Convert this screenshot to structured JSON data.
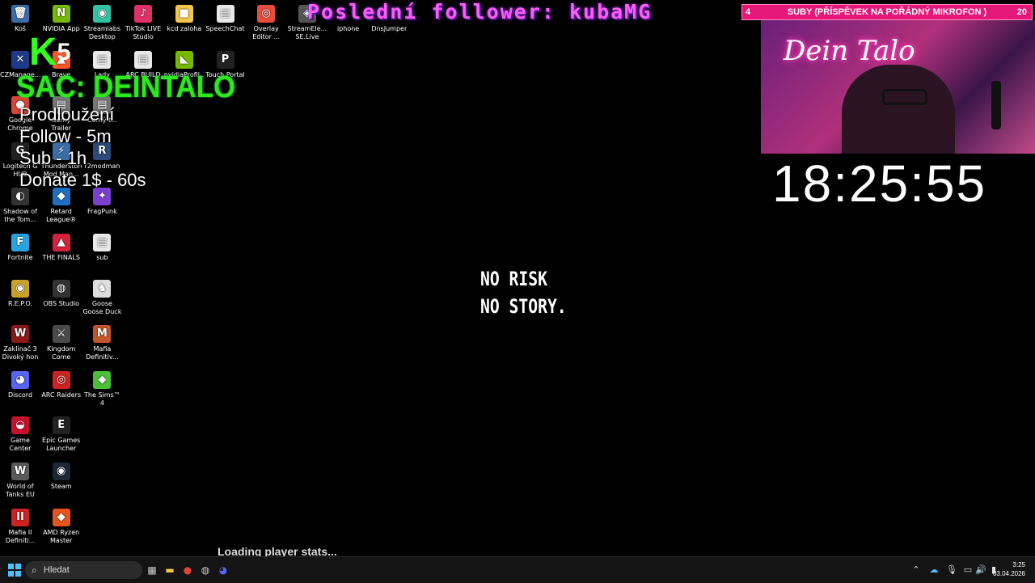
{
  "desktop_icons": [
    {
      "label": "Koš",
      "glyph": "🗑",
      "color": "#3b6ea8"
    },
    {
      "label": "NVIDIA App",
      "glyph": "N",
      "color": "#76b900"
    },
    {
      "label": "Streamlabs Desktop",
      "glyph": "◉",
      "color": "#31c3a2"
    },
    {
      "label": "TikTok LIVE Studio",
      "glyph": "♪",
      "color": "#e0306a"
    },
    {
      "label": "kcd zaloha",
      "glyph": "■",
      "color": "#f2c84b"
    },
    {
      "label": "SpeechChat",
      "glyph": "▤",
      "color": "#e8e8e8"
    },
    {
      "label": "Overlay Editor ...",
      "glyph": "◎",
      "color": "#e74c3c"
    },
    {
      "label": "StreamEle... SE.Live",
      "glyph": "◈",
      "color": "#555"
    },
    {
      "label": "iphone",
      "glyph": "",
      "color": "transparent"
    },
    {
      "label": "DnsJumper",
      "glyph": "",
      "color": "transparent"
    },
    {
      "label": "CZManage...",
      "glyph": "✕",
      "color": "#1e3a8a"
    },
    {
      "label": "Brave",
      "glyph": "▲",
      "color": "#fb542b"
    },
    {
      "label": "Lady",
      "glyph": "▤",
      "color": "#e8e8e8"
    },
    {
      "label": "ARC BUILD",
      "glyph": "▤",
      "color": "#e8e8e8"
    },
    {
      "label": "nvidiaProfil...",
      "glyph": "◣",
      "color": "#76b900"
    },
    {
      "label": "Touch Portal",
      "glyph": "P",
      "color": "#222"
    },
    {
      "label": "Google Chrome",
      "glyph": "●",
      "color": "#db4437"
    },
    {
      "label": "Černý Trailer",
      "glyph": "▤",
      "color": "#777"
    },
    {
      "label": "Černý t...",
      "glyph": "▤",
      "color": "#777"
    },
    {
      "label": "Logitech G HUB",
      "glyph": "G",
      "color": "#222"
    },
    {
      "label": "Thunderstore Mod Man...",
      "glyph": "⚡",
      "color": "#3b6ea8"
    },
    {
      "label": "r2modman",
      "glyph": "R",
      "color": "#2c4a7a"
    },
    {
      "label": "Shadow of the Tom...",
      "glyph": "◐",
      "color": "#333"
    },
    {
      "label": "Retard League®",
      "glyph": "◆",
      "color": "#1f6fc2"
    },
    {
      "label": "FragPunk",
      "glyph": "✦",
      "color": "#7b3fd1"
    },
    {
      "label": "Fortnite",
      "glyph": "F",
      "color": "#2aa4e0"
    },
    {
      "label": "THE FINALS",
      "glyph": "▲",
      "color": "#d4213d"
    },
    {
      "label": "sub",
      "glyph": "▤",
      "color": "#e8e8e8"
    },
    {
      "label": "R.E.P.O.",
      "glyph": "◉",
      "color": "#c9a227"
    },
    {
      "label": "OBS Studio",
      "glyph": "◍",
      "color": "#333"
    },
    {
      "label": "Goose Goose Duck",
      "glyph": "♞",
      "color": "#ddd"
    },
    {
      "label": "Zaklínač 3 Divoký hon",
      "glyph": "W",
      "color": "#8b1a1a"
    },
    {
      "label": "Kingdom Come Deliv...",
      "glyph": "⚔",
      "color": "#4a4a4a"
    },
    {
      "label": "Mafia Definitiv...",
      "glyph": "M",
      "color": "#c4572a"
    },
    {
      "label": "Discord",
      "glyph": "◕",
      "color": "#5865f2"
    },
    {
      "label": "ARC Raiders",
      "glyph": "◎",
      "color": "#c22"
    },
    {
      "label": "The Sims™ 4",
      "glyph": "◆",
      "color": "#4bbf3a"
    },
    {
      "label": "Game Center",
      "glyph": "◒",
      "color": "#c8102e"
    },
    {
      "label": "Epic Games Launcher",
      "glyph": "E",
      "color": "#222"
    },
    {
      "label": "World of Tanks EU",
      "glyph": "W",
      "color": "#5a5a5a"
    },
    {
      "label": "Steam",
      "glyph": "◉",
      "color": "#1b2838"
    },
    {
      "label": "Mafia II Definiti...",
      "glyph": "II",
      "color": "#c22"
    },
    {
      "label": "AMD Ryzen Master",
      "glyph": "◆",
      "color": "#e8541e"
    }
  ],
  "overlay": {
    "follower_text": "Poslední follower: kubaMG",
    "goal_left": "4",
    "goal_title": "SUBY (PŘÍSPĚVEK NA POŘÁDNÝ MIKROFON )",
    "goal_right": "20",
    "cam_sign": "Dein Talo",
    "timer": "18:25:55",
    "k5_letter": "K",
    "k5_num": "5",
    "sac_text": "SAC: DEINTALO",
    "ext_title": "Prodloužení",
    "ext_lines": [
      "Follow - 5m",
      "Sub - 1h",
      "Donate 1$ - 60s"
    ],
    "slogan_1": "NO RISK",
    "slogan_2": "NO STORY.",
    "loading": "Loading player stats..."
  },
  "taskbar": {
    "search_placeholder": "Hledat",
    "time": "3:25",
    "date": "03.04.2026",
    "accent": "#4cc2ff"
  }
}
